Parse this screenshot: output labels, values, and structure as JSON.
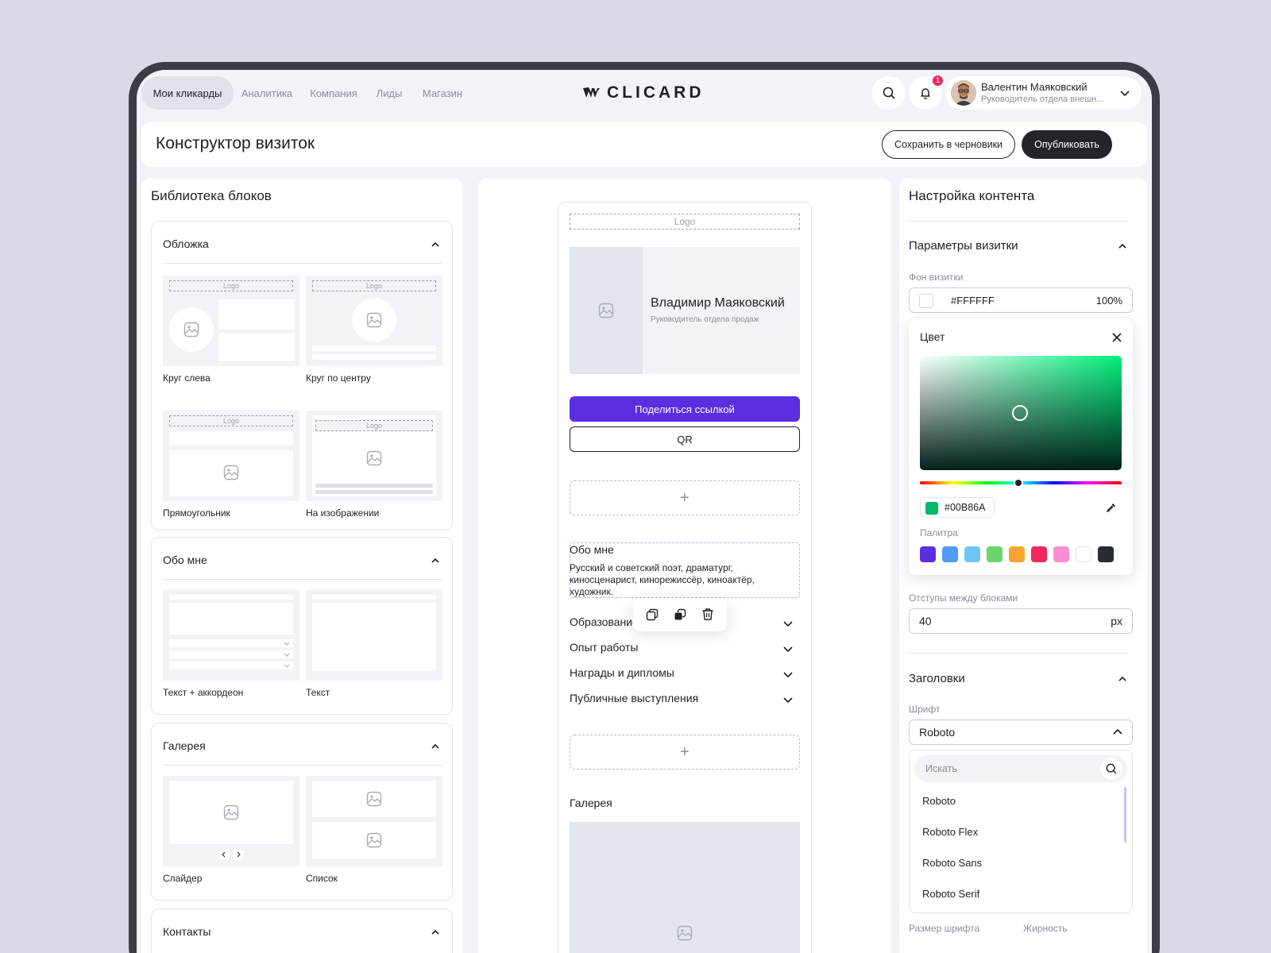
{
  "nav": {
    "tabs": [
      "Мои кликарды",
      "Аналитика",
      "Компания",
      "Лиды",
      "Магазин"
    ],
    "brand": "CLICARD",
    "notifications_count": "1",
    "user": {
      "name": "Валентин Маяковский",
      "role": "Руководитель отдела внешн..."
    }
  },
  "header": {
    "title": "Конструктор визиток",
    "save_draft": "Сохранить в черновики",
    "publish": "Опубликовать"
  },
  "library": {
    "title": "Библиотека блоков",
    "sections": [
      {
        "title": "Обложка",
        "items": [
          "Круг слева",
          "Круг по центру",
          "Прямоугольник",
          "На изображении"
        ]
      },
      {
        "title": "Обо мне",
        "items": [
          "Текст + аккордеон",
          "Текст"
        ]
      },
      {
        "title": "Галерея",
        "items": [
          "Слайдер",
          "Список"
        ]
      },
      {
        "title": "Контакты",
        "items": []
      }
    ],
    "logo_placeholder": "Logo"
  },
  "preview": {
    "logo": "Logo",
    "name": "Владимир Маяковский",
    "role": "Руководитель отдела продаж",
    "share_button": "Поделиться ссылкой",
    "qr_button": "QR",
    "add_symbol": "+",
    "about_title": "Обо мне",
    "about_text": "Русский и советский поэт, драматург, киносценарист, кинорежиссёр, киноактёр, художник.",
    "accordion": [
      "Образование",
      "Опыт работы",
      "Награды и дипломы",
      "Публичные выступления"
    ],
    "gallery_title": "Галерея"
  },
  "settings": {
    "title": "Настройка контента",
    "card_params": {
      "title": "Параметры визитки",
      "bg_label": "Фон визитки",
      "bg_value": "#FFFFFF",
      "bg_opacity": "100%",
      "spacing_label": "Отступы между блоками",
      "spacing_value": "40",
      "spacing_unit": "px"
    },
    "color_picker": {
      "title": "Цвет",
      "hex": "#00B86A",
      "palette_label": "Палитра",
      "palette": [
        "#5b2ee0",
        "#4f9cf9",
        "#6ec6f5",
        "#6ad66a",
        "#f7a531",
        "#f2295b",
        "#f78ed6",
        "#ffffff",
        "#2a2c33"
      ]
    },
    "headings": {
      "title": "Заголовки",
      "font_label": "Шрифт",
      "font_value": "Roboto",
      "search_placeholder": "Искать",
      "fonts": [
        "Roboto",
        "Roboto Flex",
        "Roboto Sans",
        "Roboto Serif"
      ],
      "size_label": "Размер шрифта",
      "weight_label": "Жирность"
    }
  },
  "colors": {
    "accent": "#5b2ee0",
    "selected": "#00B86A",
    "dark": "#23252b"
  }
}
